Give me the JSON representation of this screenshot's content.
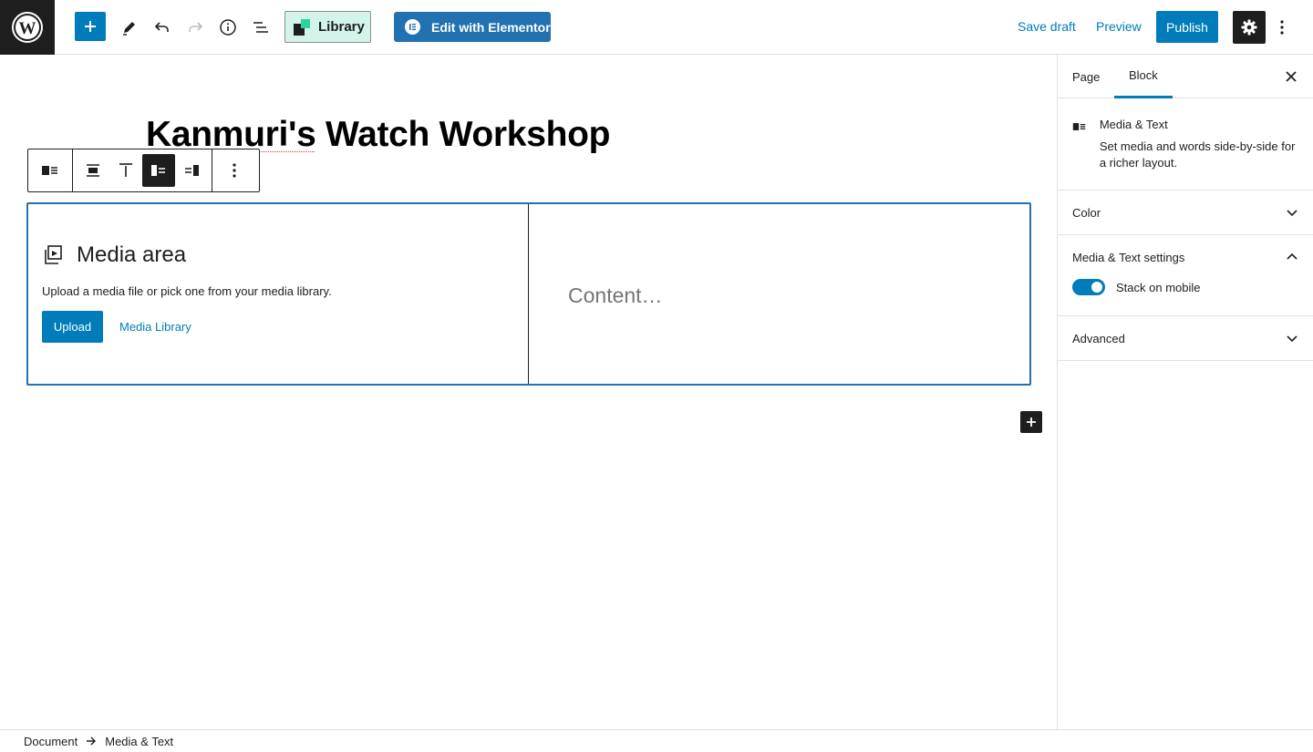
{
  "topbar": {
    "library_label": "Library",
    "elementor_label": "Edit with Elementor",
    "save_draft_label": "Save draft",
    "preview_label": "Preview",
    "publish_label": "Publish"
  },
  "editor": {
    "title_part1": "Kanmuri's",
    "title_part2": " Watch Workshop",
    "media": {
      "heading": "Media area",
      "description": "Upload a media file or pick one from your media library.",
      "upload_label": "Upload",
      "library_label": "Media Library"
    },
    "content_placeholder": "Content…"
  },
  "sidebar": {
    "tabs": [
      {
        "label": "Page"
      },
      {
        "label": "Block"
      }
    ],
    "block": {
      "name": "Media & Text",
      "description": "Set media and words side-by-side for a richer layout."
    },
    "panels": {
      "color": "Color",
      "settings": "Media & Text settings",
      "stack_label": "Stack on mobile",
      "stack_on": true,
      "advanced": "Advanced"
    }
  },
  "breadcrumb": {
    "root": "Document",
    "current": "Media & Text"
  },
  "colors": {
    "accent": "#007cba",
    "dark": "#1e1e1e",
    "library_bg": "#d2f4ea",
    "elementor": "#2271b1"
  }
}
